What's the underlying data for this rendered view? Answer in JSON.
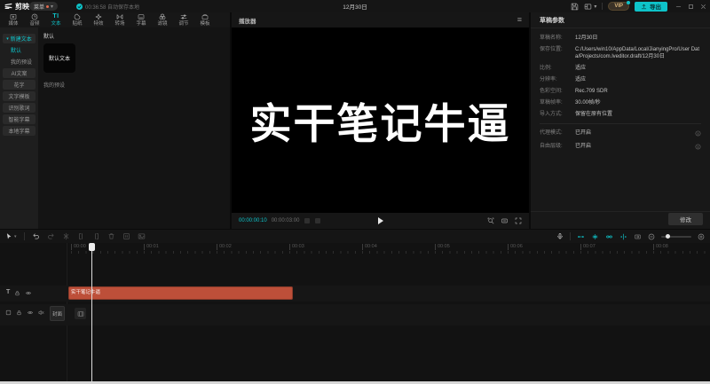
{
  "colors": {
    "accent": "#0ec3c9",
    "clip": "#bd4f39"
  },
  "titlebar": {
    "logo_text": "剪映",
    "menu_label": "菜单",
    "autosave_text": "00:36:58 自动保存本地",
    "project_title": "12月30日",
    "vip_label": "VIP",
    "export_label": "导出"
  },
  "tabs": {
    "items": [
      {
        "label": "媒体"
      },
      {
        "label": "音频"
      },
      {
        "label": "文本",
        "icon_text": "TI",
        "active": true
      },
      {
        "label": "贴纸"
      },
      {
        "label": "特效"
      },
      {
        "label": "转场"
      },
      {
        "label": "字幕"
      },
      {
        "label": "滤镜"
      },
      {
        "label": "调节"
      },
      {
        "label": "模板"
      }
    ]
  },
  "text_panel": {
    "sidebar": [
      {
        "label": "新建文本"
      },
      {
        "label": "默认"
      },
      {
        "label": "我的预设"
      },
      {
        "label": "AI文案"
      },
      {
        "label": "花字"
      },
      {
        "label": "文字模板"
      },
      {
        "label": "识别歌词"
      },
      {
        "label": "智能字幕"
      },
      {
        "label": "本地字幕"
      }
    ],
    "section_default": "默认",
    "default_card_label": "默认文本",
    "section_presets": "我的预设"
  },
  "player": {
    "title": "播放器",
    "canvas_text": "实干笔记牛逼",
    "current_time": "00:00:00:10",
    "total_time": "00:00:03:00"
  },
  "draft": {
    "title": "草稿参数",
    "fields": [
      {
        "label": "草稿名称:",
        "value": "12月30日"
      },
      {
        "label": "保存位置:",
        "value": "C:/Users/win10/AppData/Local/JianyingPro/User Data/Projects/com.lveditor.draft/12月30日"
      },
      {
        "label": "比例:",
        "value": "适应"
      },
      {
        "label": "分辨率:",
        "value": "适应"
      },
      {
        "label": "色彩空间:",
        "value": "Rec.709 SDR"
      },
      {
        "label": "草稿帧率:",
        "value": "30.00帧/秒"
      },
      {
        "label": "导入方式:",
        "value": "保留在原有位置"
      }
    ],
    "toggles": [
      {
        "label": "代理模式:",
        "value": "已开启"
      },
      {
        "label": "自由层级:",
        "value": "已开启"
      }
    ],
    "modify_label": "修改"
  },
  "timeline": {
    "ruler_labels": [
      "00:00",
      "00:01",
      "00:02",
      "00:03",
      "00:04",
      "00:05",
      "00:06",
      "00:07",
      "00:08"
    ],
    "text_track_icon": "T",
    "clip_label": "实干笔记牛逼",
    "cover_label": "封面"
  }
}
